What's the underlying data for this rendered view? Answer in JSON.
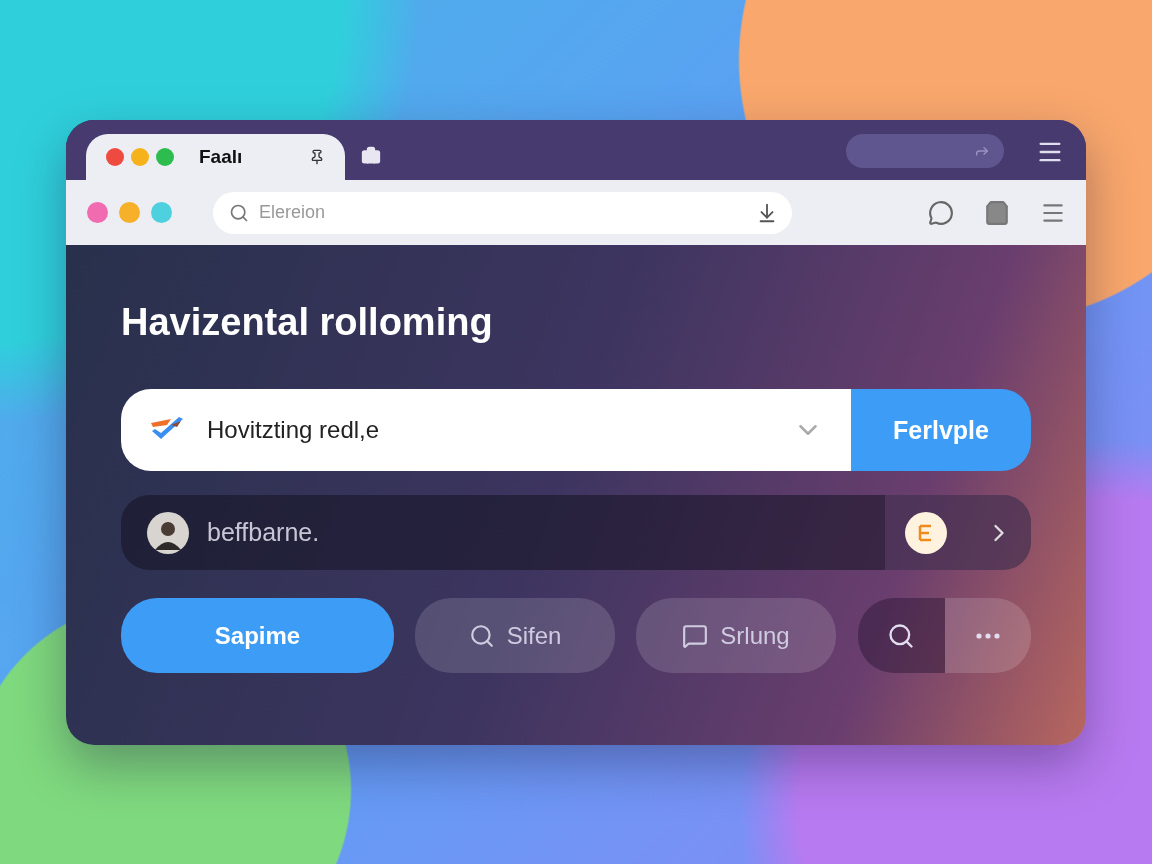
{
  "tabs": [
    {
      "title": "Faalı",
      "selected": true
    }
  ],
  "toolbar": {
    "search": {
      "placeholder": "Elereion"
    }
  },
  "heading": "Havizental rolloming",
  "picker": {
    "value": "Hovitzting redl,e",
    "button": "Ferlvple"
  },
  "profile_row": {
    "name": "beffbarne."
  },
  "actions": [
    {
      "kind": "primary",
      "label": "Sapime"
    },
    {
      "kind": "search",
      "label": "Sifen"
    },
    {
      "kind": "message",
      "label": "Srlung"
    }
  ]
}
